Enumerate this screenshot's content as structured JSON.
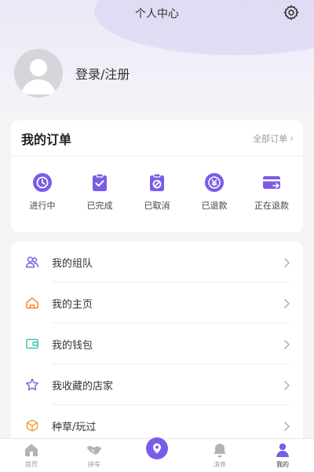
{
  "header": {
    "title": "个人中心",
    "settings_icon": "gear-icon"
  },
  "profile": {
    "login_label": "登录/注册",
    "avatar_icon": "user-avatar-icon"
  },
  "orders": {
    "title": "我的订单",
    "all_label": "全部订单",
    "items": [
      {
        "label": "进行中",
        "icon": "clock-icon"
      },
      {
        "label": "已完成",
        "icon": "clipboard-check-icon"
      },
      {
        "label": "已取消",
        "icon": "clipboard-cancel-icon"
      },
      {
        "label": "已退款",
        "icon": "coin-refund-icon"
      },
      {
        "label": "正在退款",
        "icon": "card-refund-icon"
      }
    ]
  },
  "menu": {
    "items": [
      {
        "label": "我的组队",
        "icon": "team-icon"
      },
      {
        "label": "我的主页",
        "icon": "home-icon"
      },
      {
        "label": "我的钱包",
        "icon": "wallet-icon"
      },
      {
        "label": "我收藏的店家",
        "icon": "star-icon"
      },
      {
        "label": "种草/玩过",
        "icon": "box-icon"
      }
    ]
  },
  "tabbar": {
    "items": [
      {
        "label": "首页",
        "icon": "home-tab-icon"
      },
      {
        "label": "拼车",
        "icon": "handshake-icon"
      },
      {
        "label": "",
        "icon": "location-pin-icon"
      },
      {
        "label": "消息",
        "icon": "bell-icon"
      },
      {
        "label": "我的",
        "icon": "person-icon"
      }
    ]
  },
  "colors": {
    "accent": "#7b5ce6",
    "home_icon": "#f08a3c",
    "wallet_icon": "#3cc7b0",
    "box_icon": "#f0a030"
  }
}
